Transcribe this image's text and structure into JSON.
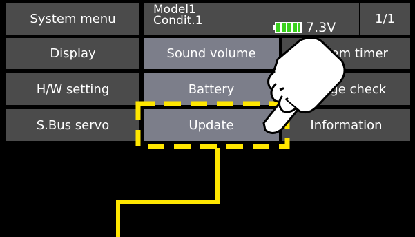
{
  "header": {
    "system_menu_label": "System menu",
    "model_name": "Model1",
    "condition": "Condit.1",
    "voltage": "7.3V",
    "page_indicator": "1/1"
  },
  "menu": {
    "row1": [
      "Display",
      "Sound volume",
      "System timer"
    ],
    "row2": [
      "H/W setting",
      "Battery",
      "Range check"
    ],
    "row3": [
      "S.Bus servo",
      "Update",
      "Information"
    ]
  },
  "colors": {
    "button_dark": "#4b4b4b",
    "button_highlight": "#7c7e8a",
    "annotation_yellow": "#ffe600",
    "battery_green": "#3bd11f"
  },
  "icons": {
    "battery": "battery-icon",
    "hand": "pointing-hand-icon"
  }
}
